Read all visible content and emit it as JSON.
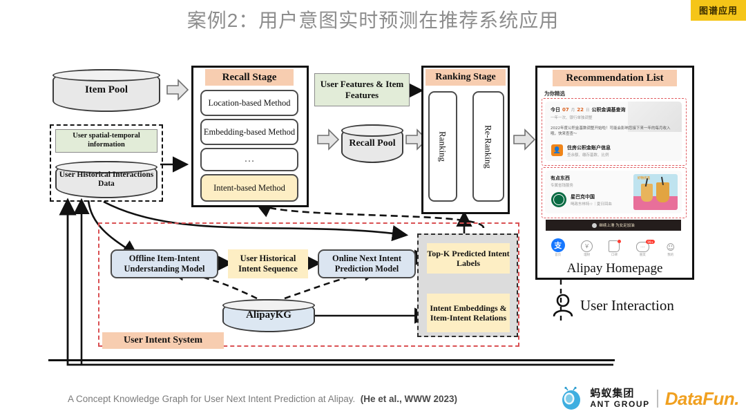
{
  "header": {
    "title": "案例2：用户意图实时预测在推荐系统应用",
    "badge": "图谱应用",
    "badge_color": "#f5c518"
  },
  "colors": {
    "header_band": "#f7cdb0",
    "green_box": "#e2ecd8",
    "yellow_box": "#fdeec4",
    "blue_box": "#dbe5f1",
    "cylinder": "#e8e8e8",
    "kg_cylinder": "#dce7f2",
    "red_dashed": "#d94f52",
    "gray_dashed_fill": "#dcdcdc"
  },
  "diagram": {
    "item_pool": "Item Pool",
    "user_spatial_temporal": "User spatial-temporal information",
    "user_historical_interactions": "User Historical Interactions Data",
    "recall_stage": {
      "title": "Recall Stage",
      "methods": [
        "Location-based Method",
        "Embedding-based Method",
        "…",
        "Intent-based Method"
      ]
    },
    "user_item_features": "User Features & Item Features",
    "recall_pool": "Recall Pool",
    "ranking_stage": {
      "title": "Ranking Stage",
      "stages": [
        "Ranking",
        "Re-Ranking"
      ]
    },
    "intent_system": {
      "label": "User Intent System",
      "offline_model": "Offline Item-Intent Understanding Model",
      "intent_sequence": "User Historical Intent Sequence",
      "online_model": "Online Next Intent Prediction Model",
      "kg": "AlipayKG",
      "outputs": [
        "Top-K Predicted Intent Labels",
        "Intent Embeddings & Item-Intent Relations"
      ]
    }
  },
  "recommendation": {
    "title": "Recommendation List",
    "homepage_label": "Alipay Homepage",
    "user_interaction": "User Interaction",
    "section_header": "为你精选",
    "card1": {
      "title_parts": [
        "今日",
        "07",
        "月",
        "22",
        "日",
        "公积金调基查询"
      ],
      "subtitle": "一年一次、银行单独调整",
      "body": "2022年度公积金基数调整开始啦！可能会影响您接下来一年的每月收入哦，快来查查～",
      "item_title": "住房公积金账户信息",
      "item_sub": "查余额、缴存基数、比例"
    },
    "card2": {
      "title": "有点东西",
      "subtitle": "专属省钱服务",
      "brand": "星巴克中国",
      "brand_sub": "喝政东林特☆｜夏日回血",
      "promo": "好物优选"
    },
    "banner": "继续上滑 为女足加油",
    "nav": [
      {
        "label": "首页",
        "icon": "alipay-logo-icon"
      },
      {
        "label": "理财",
        "icon": "finance-icon"
      },
      {
        "label": "口碑",
        "icon": "koubei-icon",
        "badge": true
      },
      {
        "label": "朋友",
        "icon": "chat-icon",
        "badge_count": "99+"
      },
      {
        "label": "我的",
        "icon": "profile-icon"
      }
    ]
  },
  "footer": {
    "caption_main": "A Concept Knowledge Graph for User Next Intent Prediction at Alipay.",
    "caption_cite": "(He et al., WWW 2023)",
    "ant_cn": "蚂蚁集团",
    "ant_en": "ANT GROUP",
    "datafun": "DataFun."
  }
}
